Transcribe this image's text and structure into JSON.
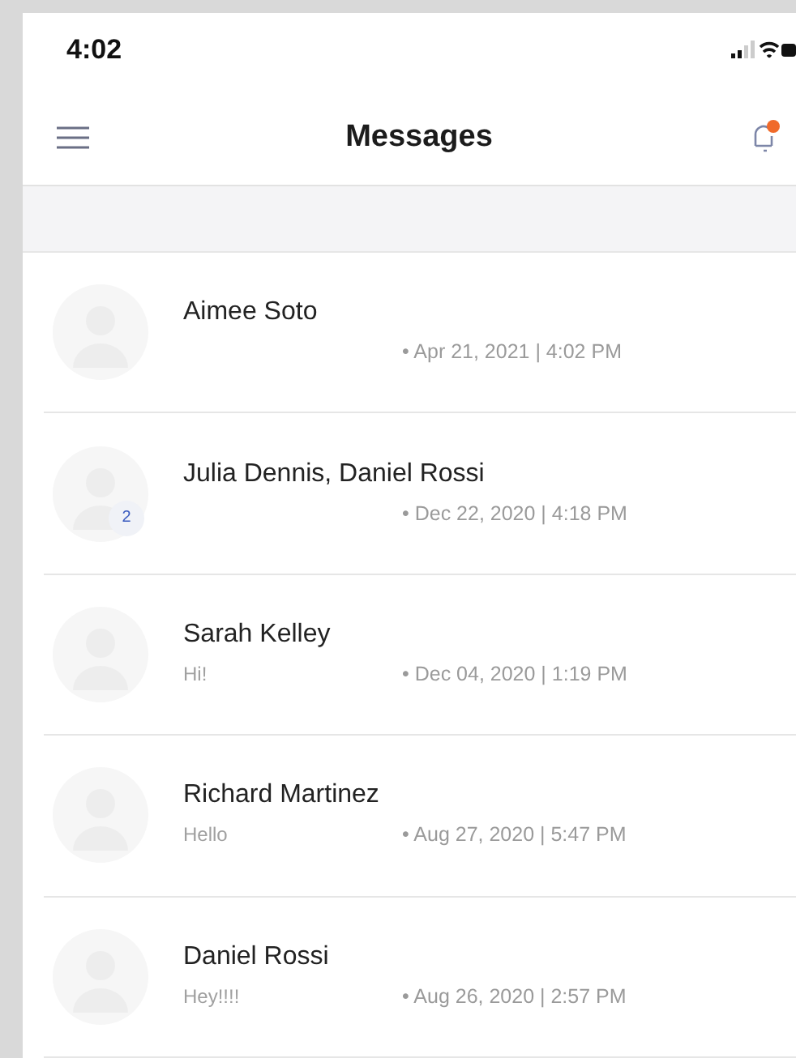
{
  "status_bar": {
    "time": "4:02"
  },
  "header": {
    "title": "Messages",
    "notification_dot": true
  },
  "conversations": [
    {
      "name": "Aimee Soto",
      "date": "• Apr 21, 2021 | 4:02 PM"
    },
    {
      "name": "Julia Dennis, Daniel Rossi",
      "date": "• Dec 22, 2020 | 4:18 PM",
      "badge": "2"
    },
    {
      "name": "Sarah Kelley",
      "preview": "Hi!",
      "date": "• Dec 04, 2020 | 1:19 PM"
    },
    {
      "name": "Richard Martinez",
      "preview": "Hello",
      "date": "• Aug 27, 2020 | 5:47 PM"
    },
    {
      "name": "Daniel Rossi",
      "preview": "Hey!!!!",
      "date": "• Aug 26, 2020 | 2:57 PM"
    }
  ]
}
